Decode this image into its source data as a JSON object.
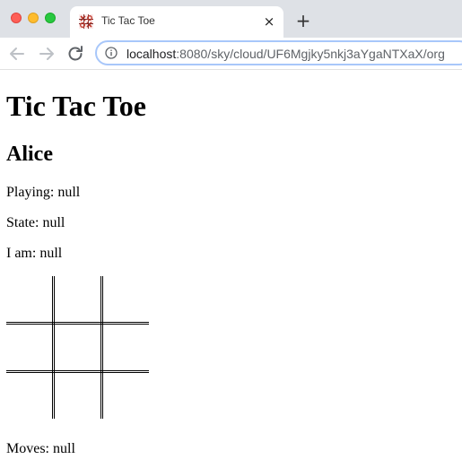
{
  "browser": {
    "tab_title": "Tic Tac Toe",
    "close_glyph": "×",
    "new_tab_glyph": "+",
    "url_host": "localhost",
    "url_rest": ":8080/sky/cloud/UF6Mgjky5nkj3aYgaNTXaX/org"
  },
  "page": {
    "title": "Tic Tac Toe",
    "player_name": "Alice",
    "playing": "Playing: null",
    "state": "State: null",
    "i_am": "I am: null",
    "moves": "Moves: null"
  },
  "board": {
    "cells": [
      "",
      "",
      "",
      "",
      "",
      "",
      "",
      "",
      ""
    ]
  },
  "icons": {
    "back": "arrow-left-icon",
    "forward": "arrow-right-icon",
    "reload": "reload-icon",
    "info": "info-icon",
    "favicon": "tic-tac-toe-favicon"
  },
  "colors": {
    "tabstrip": "#dee1e6",
    "omnibox_border": "#a8c7fa"
  }
}
